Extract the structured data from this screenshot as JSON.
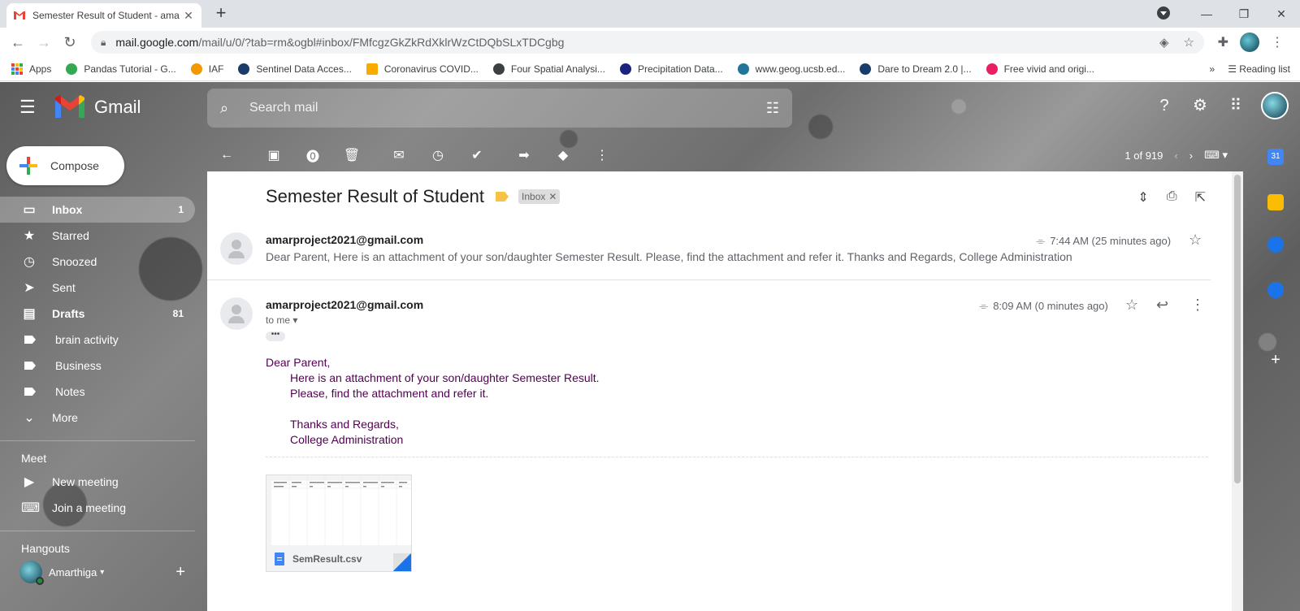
{
  "browser": {
    "tab_title": "Semester Result of Student - ama",
    "url_host": "mail.google.com",
    "url_path": "/mail/u/0/?tab=rm&ogbl#inbox/FMfcgzGkZkRdXklrWzCtDQbSLxTDCgbg",
    "bookmarks": [
      {
        "label": "Apps",
        "color": "#ea4335"
      },
      {
        "label": "Pandas Tutorial - G...",
        "color": "#34a853"
      },
      {
        "label": "IAF",
        "color": "#f29900"
      },
      {
        "label": "Sentinel Data Acces...",
        "color": "#1a3c6b"
      },
      {
        "label": "Coronavirus COVID...",
        "color": "#f9ab00"
      },
      {
        "label": "Four Spatial Analysi...",
        "color": "#3c4043"
      },
      {
        "label": "Precipitation Data...",
        "color": "#1a237e"
      },
      {
        "label": "www.geog.ucsb.ed...",
        "color": "#21759b"
      },
      {
        "label": "Dare to Dream 2.0 |...",
        "color": "#1a3c6b"
      },
      {
        "label": "Free vivid and origi...",
        "color": "#e91e63"
      }
    ],
    "reading_list": "Reading list"
  },
  "gmail": {
    "brand": "Gmail",
    "search_placeholder": "Search mail",
    "compose": "Compose",
    "nav": [
      {
        "label": "Inbox",
        "count": "1",
        "icon": "inbox-icon",
        "glyph": "▭"
      },
      {
        "label": "Starred",
        "count": "",
        "icon": "star-icon",
        "glyph": "★"
      },
      {
        "label": "Snoozed",
        "count": "",
        "icon": "clock-icon",
        "glyph": "◷"
      },
      {
        "label": "Sent",
        "count": "",
        "icon": "send-icon",
        "glyph": "➤"
      },
      {
        "label": "Drafts",
        "count": "81",
        "icon": "draft-icon",
        "glyph": "▤"
      },
      {
        "label": "brain activity",
        "count": "",
        "icon": "label-icon",
        "glyph": ""
      },
      {
        "label": "Business",
        "count": "",
        "icon": "label-icon",
        "glyph": ""
      },
      {
        "label": "Notes",
        "count": "",
        "icon": "label-icon",
        "glyph": ""
      },
      {
        "label": "More",
        "count": "",
        "icon": "chevron-down-icon",
        "glyph": "⌄"
      }
    ],
    "meet": {
      "title": "Meet",
      "new_meeting": "New meeting",
      "join_meeting": "Join a meeting"
    },
    "hangouts": {
      "title": "Hangouts",
      "user": "Amarthiga"
    },
    "pagination": "1 of 919"
  },
  "thread": {
    "subject": "Semester Result of Student",
    "label_chip": "Inbox",
    "messages": [
      {
        "sender": "amarproject2021@gmail.com",
        "time": "7:44 AM (25 minutes ago)",
        "snippet": "Dear Parent, Here is an attachment of your son/daughter Semester Result. Please, find the attachment and refer it. Thanks and Regards, College Administration"
      },
      {
        "sender": "amarproject2021@gmail.com",
        "time": "8:09 AM (0 minutes ago)",
        "to": "to me",
        "body": {
          "greeting": "Dear Parent,",
          "line1": "Here is an attachment of your son/daughter Semester Result.",
          "line2": "Please, find the attachment and refer it.",
          "line3": "Thanks and Regards,",
          "line4": "College Administration"
        },
        "attachment": "SemResult.csv"
      }
    ]
  }
}
